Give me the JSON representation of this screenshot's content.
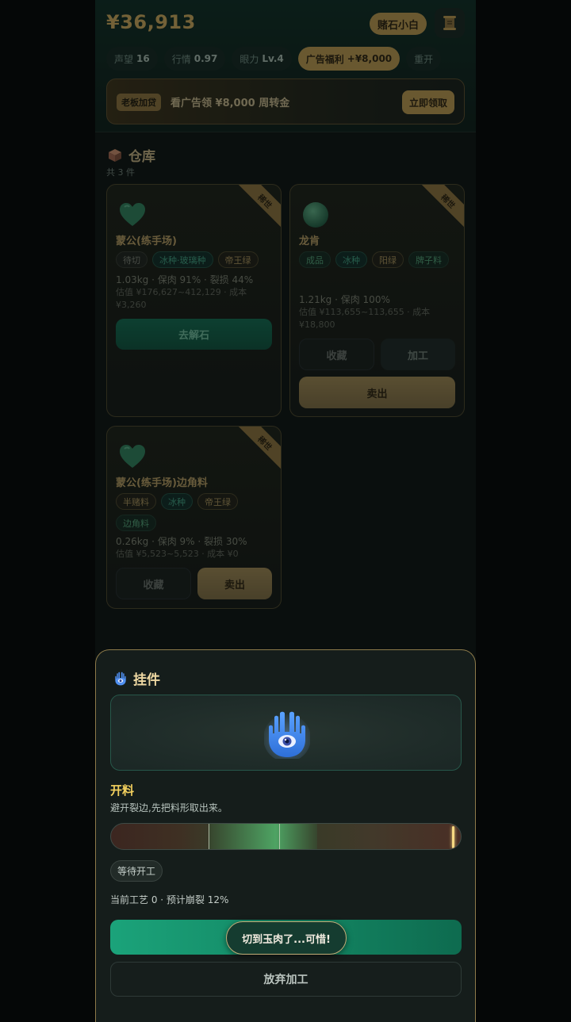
{
  "header": {
    "money": "¥36,913",
    "rank": "赌石小白",
    "stats": [
      {
        "label": "声望",
        "value": "16"
      },
      {
        "label": "行情",
        "value": "0.97"
      },
      {
        "label": "眼力",
        "value": "Lv.4"
      },
      {
        "label": "广告福利",
        "value": "+¥8,000"
      },
      {
        "label": "重开",
        "value": ""
      }
    ],
    "banner": {
      "tag": "老板加贷",
      "text": "看广告领 ¥8,000 周转金",
      "button": "立即领取"
    }
  },
  "warehouse": {
    "title": "仓库",
    "count": "共 3 件",
    "items": [
      {
        "ribbon": "稀世",
        "name": "蒙公(练手场)",
        "tags": [
          "待切",
          "冰种·玻璃种",
          "帝王绿"
        ],
        "info": "1.03kg · 保肉 91% · 裂损 44%",
        "estimate": "估值 ¥176,627~412,129 · 成本",
        "cost": "¥3,260",
        "action": "去解石"
      },
      {
        "ribbon": "稀世",
        "name": "龙肯",
        "tags": [
          "成品",
          "冰种",
          "阳绿",
          "牌子料"
        ],
        "info": "1.21kg · 保肉 100%",
        "estimate": "估值 ¥113,655~113,655 · 成本",
        "cost": "¥18,800",
        "collect": "收藏",
        "process": "加工",
        "sell": "卖出"
      },
      {
        "ribbon": "稀世",
        "name": "蒙公(练手场)边角料",
        "tags": [
          "半赌料",
          "冰种",
          "帝王绿",
          "边角料"
        ],
        "info": "0.26kg · 保肉 9% · 裂损 30%",
        "estimate": "估值 ¥5,523~5,523 · 成本 ¥0",
        "collect": "收藏",
        "sell": "卖出"
      }
    ]
  },
  "panel": {
    "title": "挂件",
    "step_title": "开料",
    "step_desc": "避开裂边,先把料形取出来。",
    "cut_zone": {
      "start": 0.28,
      "end": 0.48
    },
    "needle_position": 0.98,
    "status": "等待开工",
    "progress": "当前工艺 0 · 预计崩裂 12%",
    "toast": "切到玉肉了...可惜!",
    "abandon": "放弃加工"
  },
  "colors": {
    "gold": "#b8954d",
    "teal": "#138663",
    "jade": "#2e7d5a"
  }
}
